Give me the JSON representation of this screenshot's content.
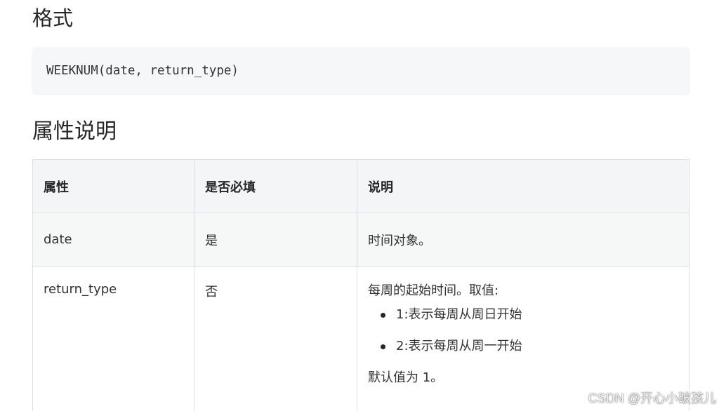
{
  "sections": {
    "format_title": "格式",
    "code": "WEEKNUM(date, return_type)",
    "attrs_title": "属性说明"
  },
  "table": {
    "headers": [
      "属性",
      "是否必填",
      "说明"
    ],
    "rows": [
      {
        "name": "date",
        "required": "是",
        "description": "时间对象。"
      },
      {
        "name": "return_type",
        "required": "否",
        "description": "每周的起始时间。取值:",
        "options": [
          "1:表示每周从周日开始",
          "2:表示每周从周一开始"
        ],
        "default_note": "默认值为 1。"
      }
    ]
  },
  "watermark": "CSDN @开心小破孩儿"
}
